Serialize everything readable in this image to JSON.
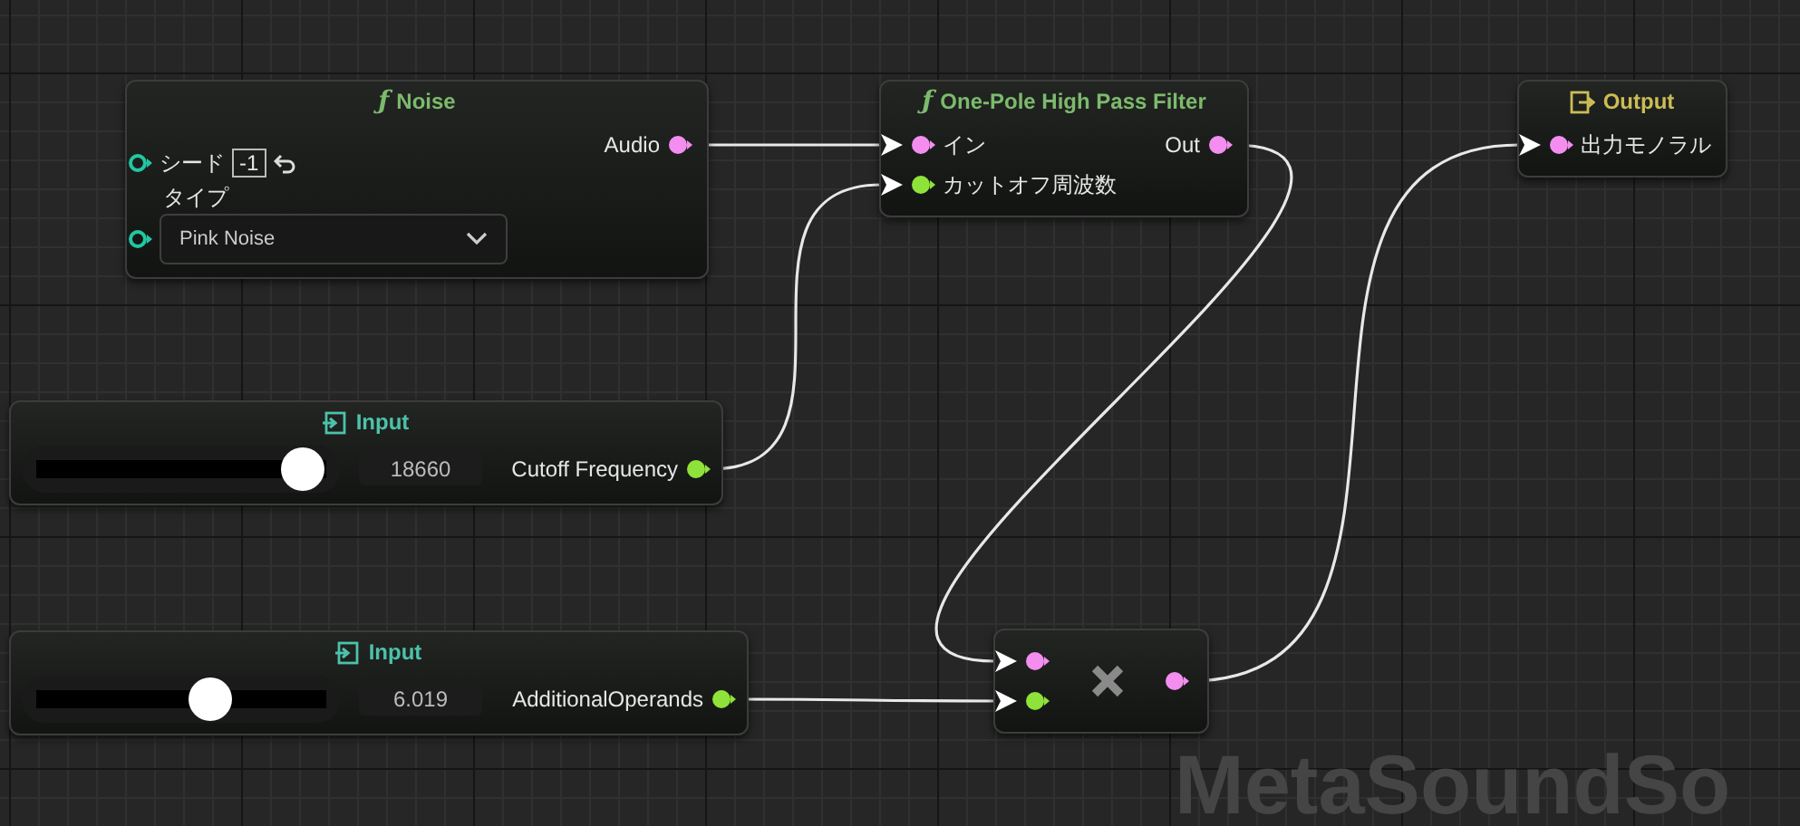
{
  "nodes": [
    {
      "kind": "function",
      "icon": "ƒ",
      "title": "Noise",
      "inputs": [
        {
          "kind": "number",
          "label": "シード",
          "color": "#22c7a2",
          "connected": false,
          "value": "-1"
        },
        {
          "kind": "dropdown",
          "label": "タイプ",
          "color": "#22c7a2",
          "connected": false,
          "value": "Pink Noise"
        }
      ],
      "outputs": [
        {
          "label": "Audio",
          "color": "#f38ef0"
        }
      ]
    },
    {
      "kind": "function",
      "icon": "ƒ",
      "title": "One-Pole High Pass Filter",
      "inputs": [
        {
          "kind": "plain",
          "label": "イン",
          "color": "#f38ef0",
          "connected": true
        },
        {
          "kind": "plain",
          "label": "カットオフ周波数",
          "color": "#8fe23a",
          "connected": true
        }
      ],
      "outputs": [
        {
          "label": "Out",
          "color": "#f38ef0"
        }
      ]
    },
    {
      "kind": "output",
      "title": "Output",
      "inputs": [
        {
          "kind": "plain",
          "label": "出力モノラル",
          "color": "#f38ef0",
          "connected": true
        }
      ]
    },
    {
      "kind": "input",
      "title": "Input",
      "level": 0.92,
      "value": "18660",
      "outputs": [
        {
          "label": "Cutoff Frequency",
          "color": "#8fe23a"
        }
      ]
    },
    {
      "kind": "input",
      "title": "Input",
      "level": 0.6,
      "value": "6.019",
      "outputs": [
        {
          "label": "AdditionalOperands",
          "color": "#8fe23a"
        }
      ]
    },
    {
      "kind": "operator",
      "inputs": [
        {
          "kind": "plain",
          "color": "#f38ef0",
          "connected": true
        },
        {
          "kind": "plain",
          "color": "#8fe23a",
          "connected": true
        }
      ],
      "outputs": [
        {
          "color": "#f38ef0"
        }
      ]
    }
  ],
  "graph_type": "MetaSoundSo"
}
